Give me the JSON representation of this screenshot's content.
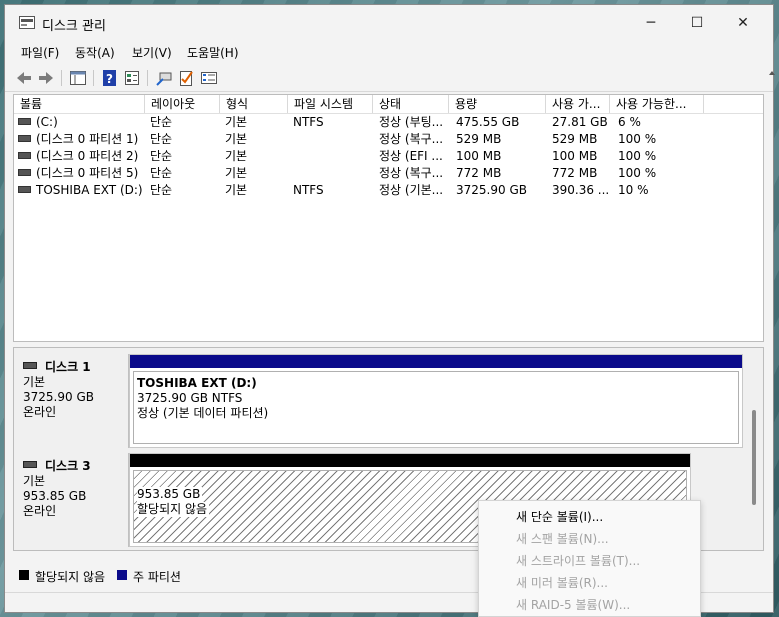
{
  "window": {
    "title": "디스크 관리",
    "controls": {
      "minimize": "─",
      "maximize": "☐",
      "close": "✕"
    }
  },
  "menu": [
    "파일(F)",
    "동작(A)",
    "보기(V)",
    "도움말(H)"
  ],
  "toolbar": {
    "icons": [
      "back-icon",
      "forward-icon",
      "show-hide-console-tree-icon",
      "help-icon",
      "properties-icon",
      "connect-icon",
      "checkmark-icon",
      "list-icon"
    ]
  },
  "volume_table": {
    "columns": [
      "볼륨",
      "레이아웃",
      "형식",
      "파일 시스템",
      "상태",
      "용량",
      "사용 가...",
      "사용 가능한..."
    ],
    "rows": [
      [
        "(C:)",
        "단순",
        "기본",
        "NTFS",
        "정상 (부팅...",
        "475.55 GB",
        "27.81 GB",
        "6 %"
      ],
      [
        "(디스크 0 파티션 1)",
        "단순",
        "기본",
        "",
        "정상 (복구...",
        "529 MB",
        "529 MB",
        "100 %"
      ],
      [
        "(디스크 0 파티션 2)",
        "단순",
        "기본",
        "",
        "정상 (EFI ...",
        "100 MB",
        "100 MB",
        "100 %"
      ],
      [
        "(디스크 0 파티션 5)",
        "단순",
        "기본",
        "",
        "정상 (복구...",
        "772 MB",
        "772 MB",
        "100 %"
      ],
      [
        "TOSHIBA EXT (D:)",
        "단순",
        "기본",
        "NTFS",
        "정상 (기본...",
        "3725.90 GB",
        "390.36 ...",
        "10 %"
      ]
    ]
  },
  "disks": [
    {
      "name": "디스크 1",
      "type": "기본",
      "size": "3725.90 GB",
      "status": "온라인",
      "partition": {
        "title": "TOSHIBA EXT  (D:)",
        "detail": "3725.90 GB NTFS",
        "status": "정상 (기본 데이터 파티션)",
        "color": "#0a0a8a"
      }
    },
    {
      "name": "디스크 3",
      "type": "기본",
      "size": "953.85 GB",
      "status": "온라인",
      "partition": {
        "detail": "953.85 GB",
        "status": "할당되지 않음",
        "color": "#000000"
      }
    }
  ],
  "legend": [
    {
      "label": "할당되지 않음",
      "color": "#000000"
    },
    {
      "label": "주 파티션",
      "color": "#0a0a8a"
    }
  ],
  "context_menu": [
    {
      "label": "새 단순 볼륨(I)...",
      "enabled": true
    },
    {
      "label": "새 스팬 볼륨(N)...",
      "enabled": false
    },
    {
      "label": "새 스트라이프 볼륨(T)...",
      "enabled": false
    },
    {
      "label": "새 미러 볼륨(R)...",
      "enabled": false
    },
    {
      "label": "새 RAID-5 볼륨(W)...",
      "enabled": false
    }
  ]
}
